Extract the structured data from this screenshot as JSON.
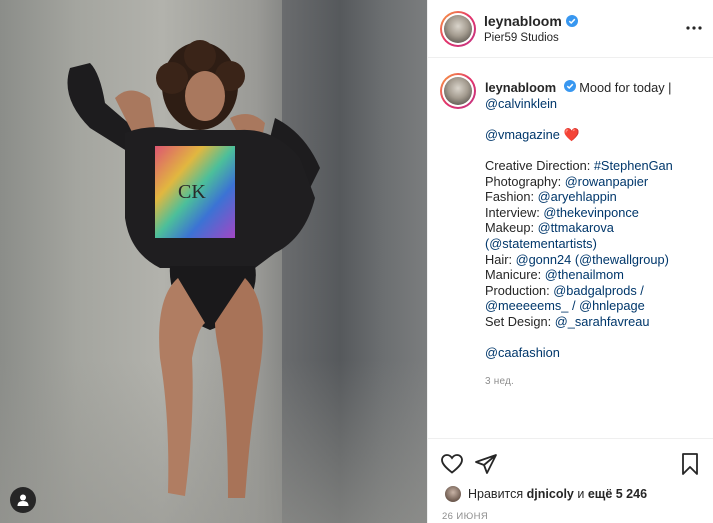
{
  "post": {
    "username": "leynabloom",
    "location": "Pier59 Studios",
    "caption": {
      "username": "leynabloom",
      "line1": "Mood for today |",
      "line2": "@calvinklein",
      "line3_link": "@vmagazine",
      "line3_emoji": "❤️",
      "credits": [
        {
          "label": "Creative Direction: ",
          "value": "#StephenGan"
        },
        {
          "label": "Photography: ",
          "value": "@rowanpapier"
        },
        {
          "label": "Fashion: ",
          "value": "@aryehlappin"
        },
        {
          "label": "Interview: ",
          "value": "@thekevinponce"
        },
        {
          "label": "Makeup: ",
          "value": "@ttmakarova"
        },
        {
          "label": "",
          "value": "(@statementartists)"
        },
        {
          "label": "Hair: ",
          "value": "@gonn24 (@thewallgroup)"
        },
        {
          "label": "Manicure: ",
          "value": "@thenailmom"
        },
        {
          "label": "Production: ",
          "value": "@badgalprods /"
        },
        {
          "label": "",
          "value": "@meeeeems_ / @hnlepage"
        },
        {
          "label": "Set Design: ",
          "value": "@_sarahfavreau"
        }
      ],
      "footer_link": "@caafashion"
    },
    "time_ago": "3 нед.",
    "likes": {
      "prefix": "Нравится ",
      "user": "djnicoly",
      "middle": " и ",
      "count": "ещё 5 246"
    },
    "date": "26 ИЮНЯ"
  },
  "icons": {
    "verified": "verified-badge-icon",
    "more": "more-options-icon",
    "like": "heart-icon",
    "share": "paper-plane-icon",
    "save": "bookmark-icon",
    "tag": "user-tag-icon"
  },
  "colors": {
    "link": "#00376b",
    "verified": "#3897f0",
    "heart": "#ed4956",
    "meta": "#8e8e8e"
  }
}
